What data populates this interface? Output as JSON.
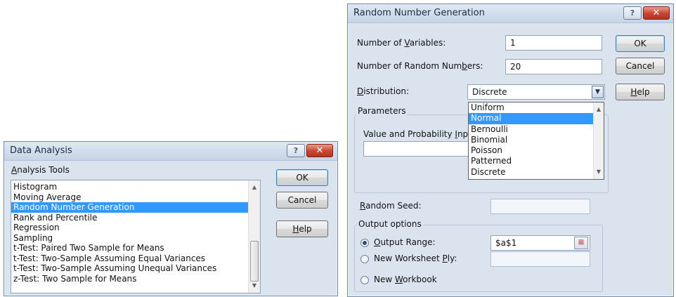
{
  "data_analysis": {
    "title": "Data Analysis",
    "help_icon": "?",
    "close_icon": "✕",
    "tools_label_pre": "",
    "tools_label_u": "A",
    "tools_label_post": "nalysis Tools",
    "tools": [
      "Histogram",
      "Moving Average",
      "Random Number Generation",
      "Rank and Percentile",
      "Regression",
      "Sampling",
      "t-Test: Paired Two Sample for Means",
      "t-Test: Two-Sample Assuming Equal Variances",
      "t-Test: Two-Sample Assuming Unequal Variances",
      "z-Test: Two Sample for Means"
    ],
    "selected_tool": "Random Number Generation",
    "ok_label": "OK",
    "cancel_label": "Cancel",
    "help_pre": "",
    "help_u": "H",
    "help_post": "elp"
  },
  "rng": {
    "title": "Random Number Generation",
    "help_icon": "?",
    "close_icon": "✕",
    "num_vars_pre": "Number of ",
    "num_vars_u": "V",
    "num_vars_post": "ariables:",
    "num_vars_value": "1",
    "num_rand_pre": "Number of Random Num",
    "num_rand_u": "b",
    "num_rand_post": "ers:",
    "num_rand_value": "20",
    "dist_pre": "",
    "dist_u": "D",
    "dist_post": "istribution:",
    "dist_value": "Discrete",
    "dist_options": [
      "Uniform",
      "Normal",
      "Bernoulli",
      "Binomial",
      "Poisson",
      "Patterned",
      "Discrete"
    ],
    "dist_highlighted": "Normal",
    "parameters_label": "Parameters",
    "value_prob_pre": "Value and Probability ",
    "value_prob_u": "I",
    "value_prob_post": "npu",
    "value_prob_value": "",
    "seed_pre": "",
    "seed_u": "R",
    "seed_post": "andom Seed:",
    "seed_value": "",
    "output_options_label": "Output options",
    "output_range_pre": "",
    "output_range_u": "O",
    "output_range_post": "utput Range:",
    "output_range_value": "$a$1",
    "new_ws_pre": "New Worksheet ",
    "new_ws_u": "P",
    "new_ws_post": "ly:",
    "new_ws_value": "",
    "new_wb_pre": "New ",
    "new_wb_u": "W",
    "new_wb_post": "orkbook",
    "selected_output": "output_range",
    "ok_label": "OK",
    "cancel_label": "Cancel",
    "help_pre": "",
    "help_u": "H",
    "help_post": "elp"
  },
  "icons": {
    "scroll_up": "▲",
    "scroll_down": "▼",
    "combo_down": "▼",
    "refedit": "⊞"
  }
}
